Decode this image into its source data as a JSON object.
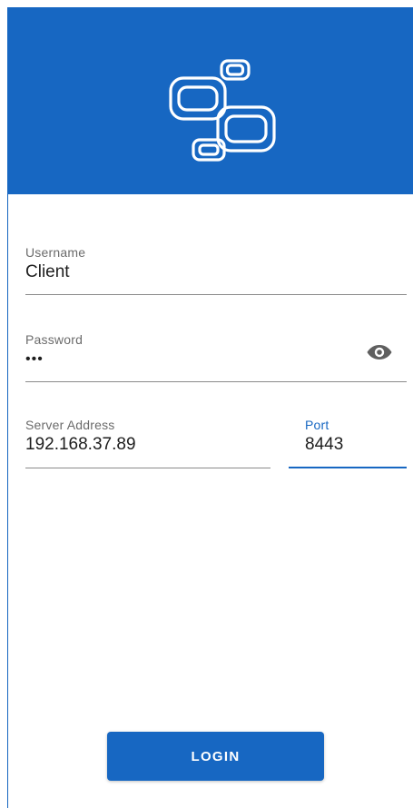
{
  "header": {
    "logo_icon": "connected-nodes-logo-icon",
    "background_color": "#1767c2"
  },
  "form": {
    "username": {
      "label": "Username",
      "value": "Client"
    },
    "password": {
      "label": "Password",
      "value": "•••",
      "toggle_icon": "eye-icon"
    },
    "server_address": {
      "label": "Server Address",
      "value": "192.168.37.89"
    },
    "port": {
      "label": "Port",
      "value": "8443"
    }
  },
  "login_button": {
    "label": "LOGIN"
  },
  "colors": {
    "primary": "#1767c2",
    "text": "#1e1e1e",
    "label": "#6b6b6b"
  }
}
